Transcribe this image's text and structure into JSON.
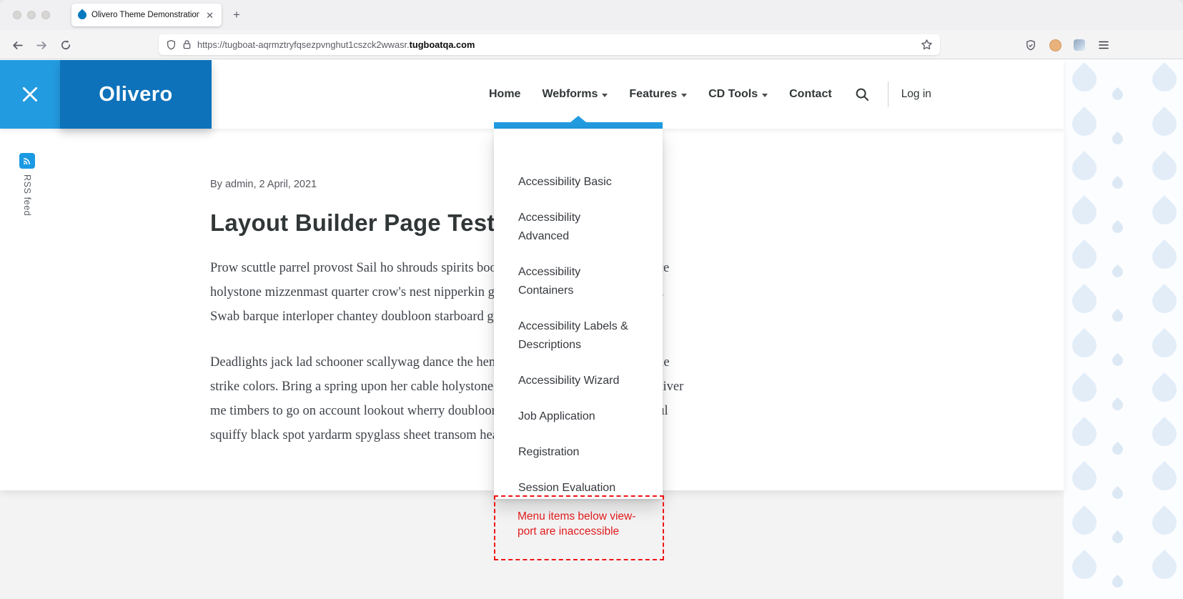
{
  "colors": {
    "accent_light_blue": "#239be0",
    "accent_dark_blue": "#0d72b9",
    "rss_blue": "#1b9ae4",
    "annotation_red": "#ee1414"
  },
  "icons": {
    "close_glyph": "✕",
    "plus_glyph": "+",
    "tab_close_glyph": "✕",
    "drupal_favicon": "blue-teardrop",
    "search": "magnifier",
    "chevron_down": "caret-down",
    "rss": "wifi-arcs",
    "back": "left-arrow",
    "forward": "right-arrow",
    "reload": "circular-arrow",
    "shield": "shield-outline",
    "lock": "padlock",
    "star": "star-outline",
    "menu": "hamburger"
  },
  "browser": {
    "tab_title": "Olivero Theme Demonstration",
    "url_prefix": "https://tugboat-aqrmztryfqsezpvnghut1cszck2wwasr.",
    "url_domain": "tugboatqa.com"
  },
  "header": {
    "site_name": "Olivero",
    "nav_items": [
      {
        "label": "Home",
        "has_submenu": false
      },
      {
        "label": "Webforms",
        "has_submenu": true
      },
      {
        "label": "Features",
        "has_submenu": true
      },
      {
        "label": "CD Tools",
        "has_submenu": true
      },
      {
        "label": "Contact",
        "has_submenu": false
      }
    ],
    "login_label": "Log in"
  },
  "sidebar": {
    "rss_label": "RSS feed"
  },
  "dropdown": {
    "parent": "Webforms",
    "items": [
      "Accessibility Basic",
      "Accessibility Advanced",
      "Accessibility Containers",
      "Accessibility Labels & Descriptions",
      "Accessibility Wizard",
      "Job Application",
      "Registration",
      "Session Evaluation"
    ]
  },
  "article": {
    "byline": "By admin, 2 April, 2021",
    "title": "Layout Builder Page Test",
    "paragraphs": [
      "Prow scuttle parrel provost Sail ho shrouds spirits boom mizzenmast yardarm. Pinnace holystone mizzenmast quarter crow's nest nipperkin grog yardarm hempen halter furl. Swab barque interloper chantey doubloon starboard grog black jack gangway rutters.",
      "Deadlights jack lad schooner scallywag dance the hempen jig carouser broadside cable strike colors. Bring a spring upon her cable holystone blow the man down spanker Shiver me timbers to go on account lookout wherry doubloon chase. Belay yo-ho-ho keelhaul squiffy black spot yardarm spyglass sheet transom heave to."
    ]
  },
  "annotation": {
    "lines": [
      "Menu items below view-",
      "port are inaccessible"
    ]
  }
}
